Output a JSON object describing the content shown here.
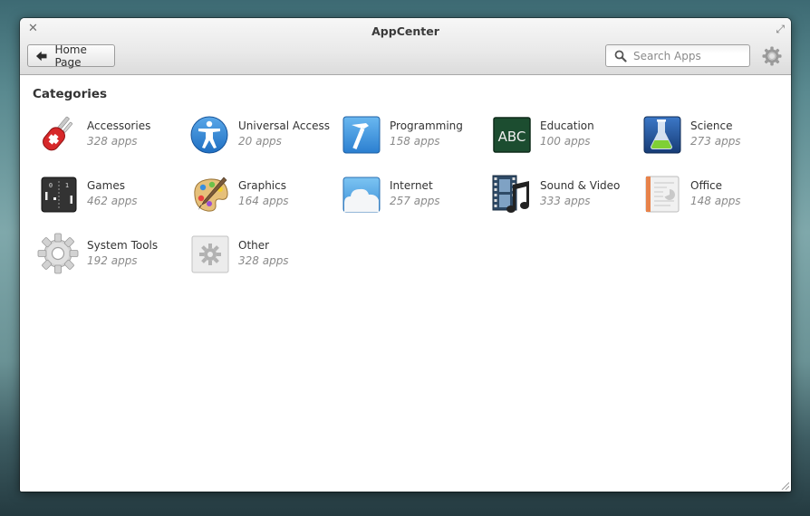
{
  "window": {
    "title": "AppCenter"
  },
  "headerbar": {
    "close_icon": "close-icon",
    "maximize_icon": "maximize-icon",
    "home_button_label": "Home Page",
    "search_placeholder": "Search Apps",
    "search_value": "",
    "settings_icon": "gear-icon"
  },
  "main": {
    "heading": "Categories",
    "categories": [
      {
        "name": "Accessories",
        "count": "328 apps",
        "icon": "accessories-icon"
      },
      {
        "name": "Universal Access",
        "count": "20 apps",
        "icon": "universal-access-icon"
      },
      {
        "name": "Programming",
        "count": "158 apps",
        "icon": "programming-icon"
      },
      {
        "name": "Education",
        "count": "100 apps",
        "icon": "education-icon"
      },
      {
        "name": "Science",
        "count": "273 apps",
        "icon": "science-icon"
      },
      {
        "name": "Games",
        "count": "462 apps",
        "icon": "games-icon"
      },
      {
        "name": "Graphics",
        "count": "164 apps",
        "icon": "graphics-icon"
      },
      {
        "name": "Internet",
        "count": "257 apps",
        "icon": "internet-icon"
      },
      {
        "name": "Sound & Video",
        "count": "333 apps",
        "icon": "sound-video-icon"
      },
      {
        "name": "Office",
        "count": "148 apps",
        "icon": "office-icon"
      },
      {
        "name": "System Tools",
        "count": "192 apps",
        "icon": "system-tools-icon"
      },
      {
        "name": "Other",
        "count": "328 apps",
        "icon": "other-icon"
      }
    ]
  }
}
